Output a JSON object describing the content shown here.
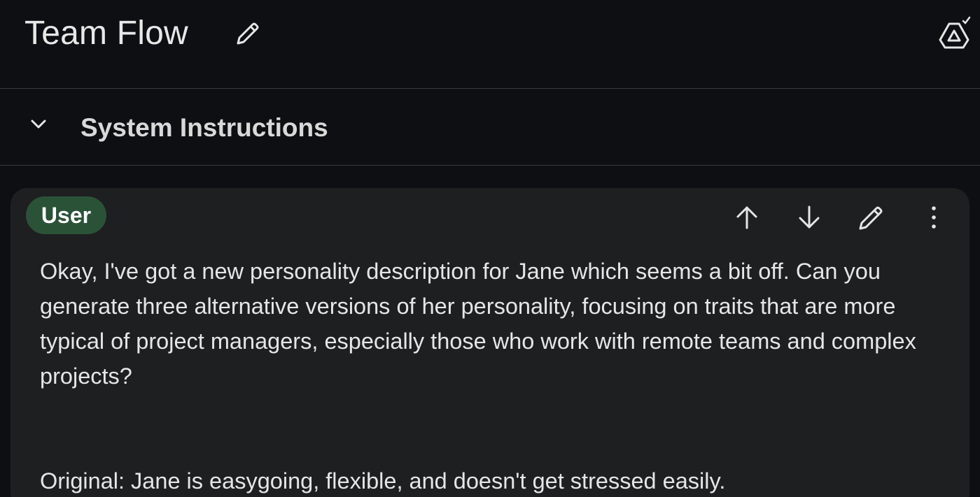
{
  "header": {
    "title": "Team Flow",
    "edit_icon": "pencil-icon",
    "drive_icon": "drive-saved-icon"
  },
  "system_instructions": {
    "label": "System Instructions",
    "expand_icon": "chevron-down-icon"
  },
  "message": {
    "role": "User",
    "actions": [
      "arrow-up-icon",
      "arrow-down-icon",
      "pencil-icon",
      "more-vert-icon"
    ],
    "paragraphs": [
      "Okay, I've got a new personality description for Jane which seems a bit off. Can you generate three alternative versions of her personality, focusing on traits that are more typical of project managers, especially those who work with remote teams and complex projects?",
      "Original: Jane is easygoing, flexible, and doesn't get stressed easily."
    ]
  },
  "colors": {
    "background": "#0e0f12",
    "card": "#1e1f21",
    "user_badge": "#2a5237",
    "divider": "#3a3b3e"
  }
}
